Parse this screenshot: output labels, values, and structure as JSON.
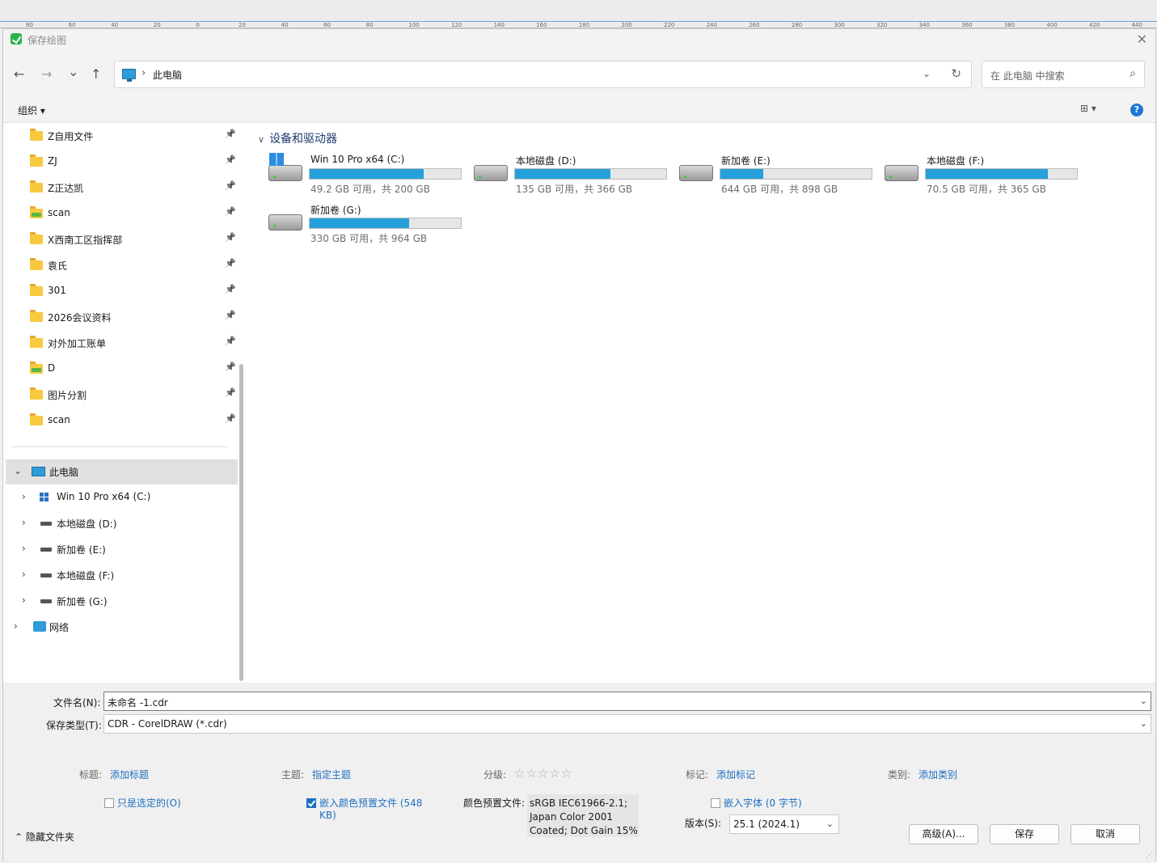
{
  "ruler": {
    "ticks": [
      "80",
      "60",
      "40",
      "20",
      "0",
      "20",
      "40",
      "60",
      "80",
      "100",
      "120",
      "140",
      "160",
      "180",
      "200",
      "220",
      "240",
      "260",
      "280",
      "300",
      "320",
      "340",
      "360",
      "380",
      "400",
      "420",
      "440"
    ]
  },
  "window": {
    "title": "保存绘图"
  },
  "nav": {
    "back": "←",
    "forward": "→",
    "recent": "⌄",
    "up": "↑"
  },
  "address": {
    "path": "此电脑",
    "separator": "›"
  },
  "search": {
    "placeholder": "在 此电脑 中搜索"
  },
  "toolbar": {
    "organize": "组织 ▾",
    "help": "?"
  },
  "sidebar": {
    "quick_access": [
      {
        "label": "Z自用文件",
        "icon": "folder-icon"
      },
      {
        "label": "ZJ",
        "icon": "folder-icon"
      },
      {
        "label": "Z正达凯",
        "icon": "folder-icon"
      },
      {
        "label": "scan",
        "icon": "folder-green-icon"
      },
      {
        "label": "X西南工区指挥部",
        "icon": "folder-icon"
      },
      {
        "label": "袁氏",
        "icon": "folder-icon"
      },
      {
        "label": "301",
        "icon": "folder-icon"
      },
      {
        "label": "2026会议资料",
        "icon": "folder-icon"
      },
      {
        "label": "对外加工账单",
        "icon": "folder-icon"
      },
      {
        "label": "D",
        "icon": "folder-green-icon"
      },
      {
        "label": "图片分割",
        "icon": "folder-icon"
      },
      {
        "label": "scan",
        "icon": "folder-icon"
      }
    ],
    "this_pc": "此电脑",
    "drives": [
      "Win 10 Pro x64 (C:)",
      "本地磁盘 (D:)",
      "新加卷 (E:)",
      "本地磁盘 (F:)",
      "新加卷 (G:)"
    ],
    "network": "网络"
  },
  "main": {
    "group_title": "设备和驱动器",
    "drives": [
      {
        "name": "Win 10 Pro x64 (C:)",
        "free": "49.2 GB 可用，共 200 GB",
        "used_fraction": 0.754,
        "system": true
      },
      {
        "name": "本地磁盘 (D:)",
        "free": "135 GB 可用，共 366 GB",
        "used_fraction": 0.631,
        "system": false
      },
      {
        "name": "新加卷 (E:)",
        "free": "644 GB 可用，共 898 GB",
        "used_fraction": 0.283,
        "system": false
      },
      {
        "name": "本地磁盘 (F:)",
        "free": "70.5 GB 可用，共 365 GB",
        "used_fraction": 0.807,
        "system": false
      },
      {
        "name": "新加卷 (G:)",
        "free": "330 GB 可用，共 964 GB",
        "used_fraction": 0.658,
        "system": false
      }
    ]
  },
  "form": {
    "filename_label": "文件名(N):",
    "filename_value": "未命名 -1.cdr",
    "type_label": "保存类型(T):",
    "type_value": "CDR - CorelDRAW (*.cdr)",
    "title_label": "标题:",
    "title_link": "添加标题",
    "subject_label": "主题:",
    "subject_link": "指定主题",
    "rating_label": "分级:",
    "rating_stars": "☆☆☆☆☆",
    "tags_label": "标记:",
    "tags_link": "添加标记",
    "category_label": "类别:",
    "category_link": "添加类别",
    "only_selected": "只是选定的(O)",
    "embed_color_line1": "嵌入颜色预置文件 (548",
    "embed_color_line2": "KB)",
    "color_profile_label": "颜色预置文件:",
    "color_profile_line1": "sRGB IEC61966-2.1;",
    "color_profile_line2": "Japan Color 2001",
    "color_profile_line3": "Coated; Dot Gain 15%",
    "embed_fonts": "嵌入字体 (0 字节)",
    "version_label": "版本(S):",
    "version_value": "25.1 (2024.1)"
  },
  "footer": {
    "hide_folders": "隐藏文件夹",
    "advanced": "高级(A)...",
    "save": "保存",
    "cancel": "取消"
  }
}
